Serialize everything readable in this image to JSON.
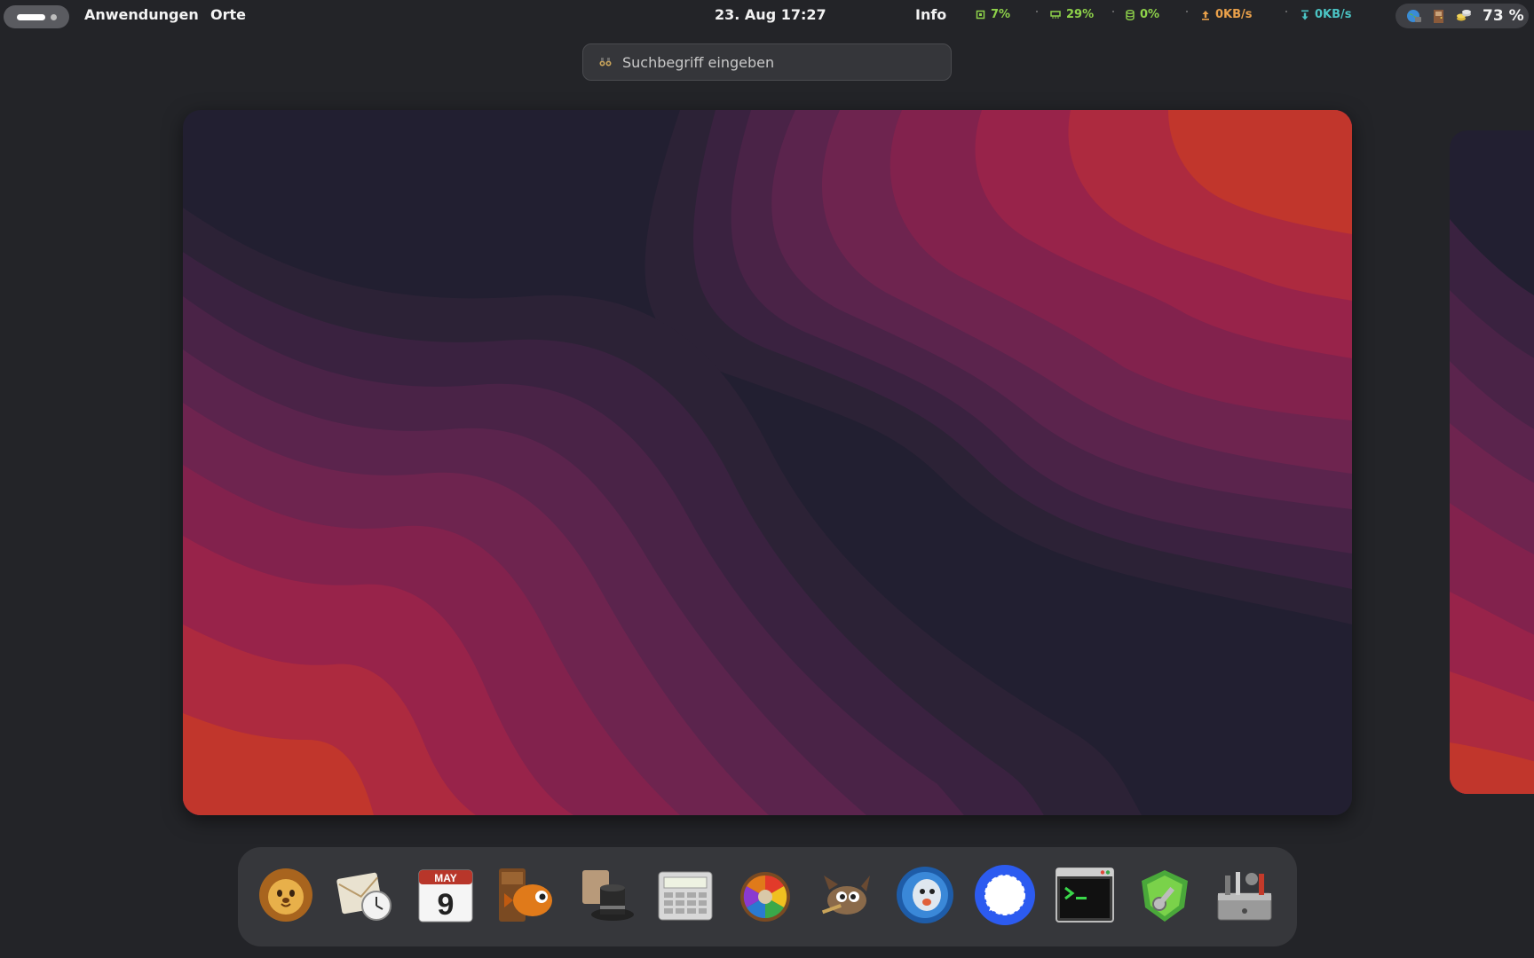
{
  "topbar": {
    "menus": [
      "Anwendungen",
      "Orte"
    ],
    "clock": "23. Aug  17:27",
    "info": "Info",
    "stats": [
      {
        "icon": "cpu-icon",
        "value": "7%",
        "color": "#8ed24a"
      },
      {
        "icon": "memory-icon",
        "value": "29%",
        "color": "#8ed24a"
      },
      {
        "icon": "disk-icon",
        "value": "0%",
        "color": "#8ed24a"
      },
      {
        "icon": "upload-icon",
        "value": "0KB/s",
        "color": "#e9a04a"
      },
      {
        "icon": "download-icon",
        "value": "0KB/s",
        "color": "#4bc4c4"
      }
    ],
    "tray": {
      "battery": "73 %"
    }
  },
  "search": {
    "placeholder": "Suchbegriff eingeben"
  },
  "dock": {
    "apps": [
      "lion-app-icon",
      "mail-scheduler-icon",
      "calendar-icon",
      "file-manager-fish-icon",
      "magician-hat-icon",
      "calculator-icon",
      "color-wheel-icon",
      "gimp-icon",
      "chat-bubble-icon",
      "signal-icon",
      "terminal-icon",
      "password-key-icon",
      "toolbox-icon"
    ],
    "calendar": {
      "month": "MAY",
      "day": "9"
    }
  }
}
